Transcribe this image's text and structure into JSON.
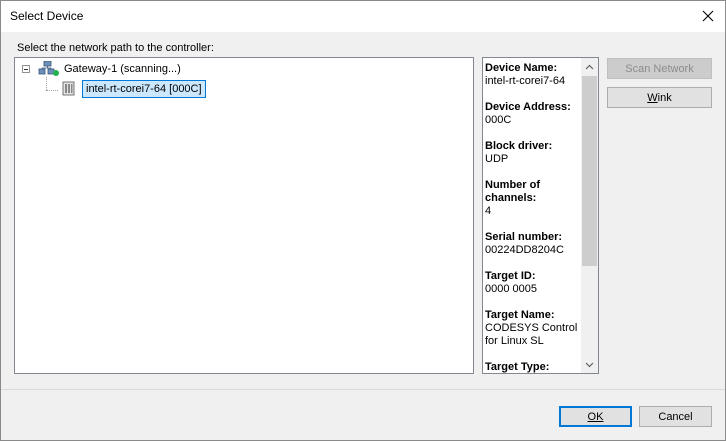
{
  "window": {
    "title": "Select Device"
  },
  "prompt": "Select the network path to the controller:",
  "tree": {
    "gateway_label": "Gateway-1 (scanning...)",
    "device_label": "intel-rt-corei7-64 [000C]"
  },
  "info": [
    {
      "label": "Device Name:",
      "value": "intel-rt-corei7-64"
    },
    {
      "label": "Device Address:",
      "value": "000C"
    },
    {
      "label": "Block driver:",
      "value": "UDP"
    },
    {
      "label": "Number of channels:",
      "value": "4"
    },
    {
      "label": "Serial number:",
      "value": "00224DD8204C"
    },
    {
      "label": "Target ID:",
      "value": "0000 0005"
    },
    {
      "label": "Target Name:",
      "value": "CODESYS Control for Linux SL"
    },
    {
      "label": "Target Type:",
      "value": ""
    }
  ],
  "buttons": {
    "scan": "Scan Network",
    "wink": "Wink",
    "ok": "OK",
    "cancel": "Cancel"
  },
  "icons": [
    "close-icon",
    "gateway-icon",
    "status-dot-icon",
    "device-icon",
    "scroll-up-icon",
    "scroll-down-icon"
  ],
  "colors": {
    "selection_bg": "#cce8ff",
    "selection_border": "#0078d7",
    "status_dot": "#22b14c"
  }
}
